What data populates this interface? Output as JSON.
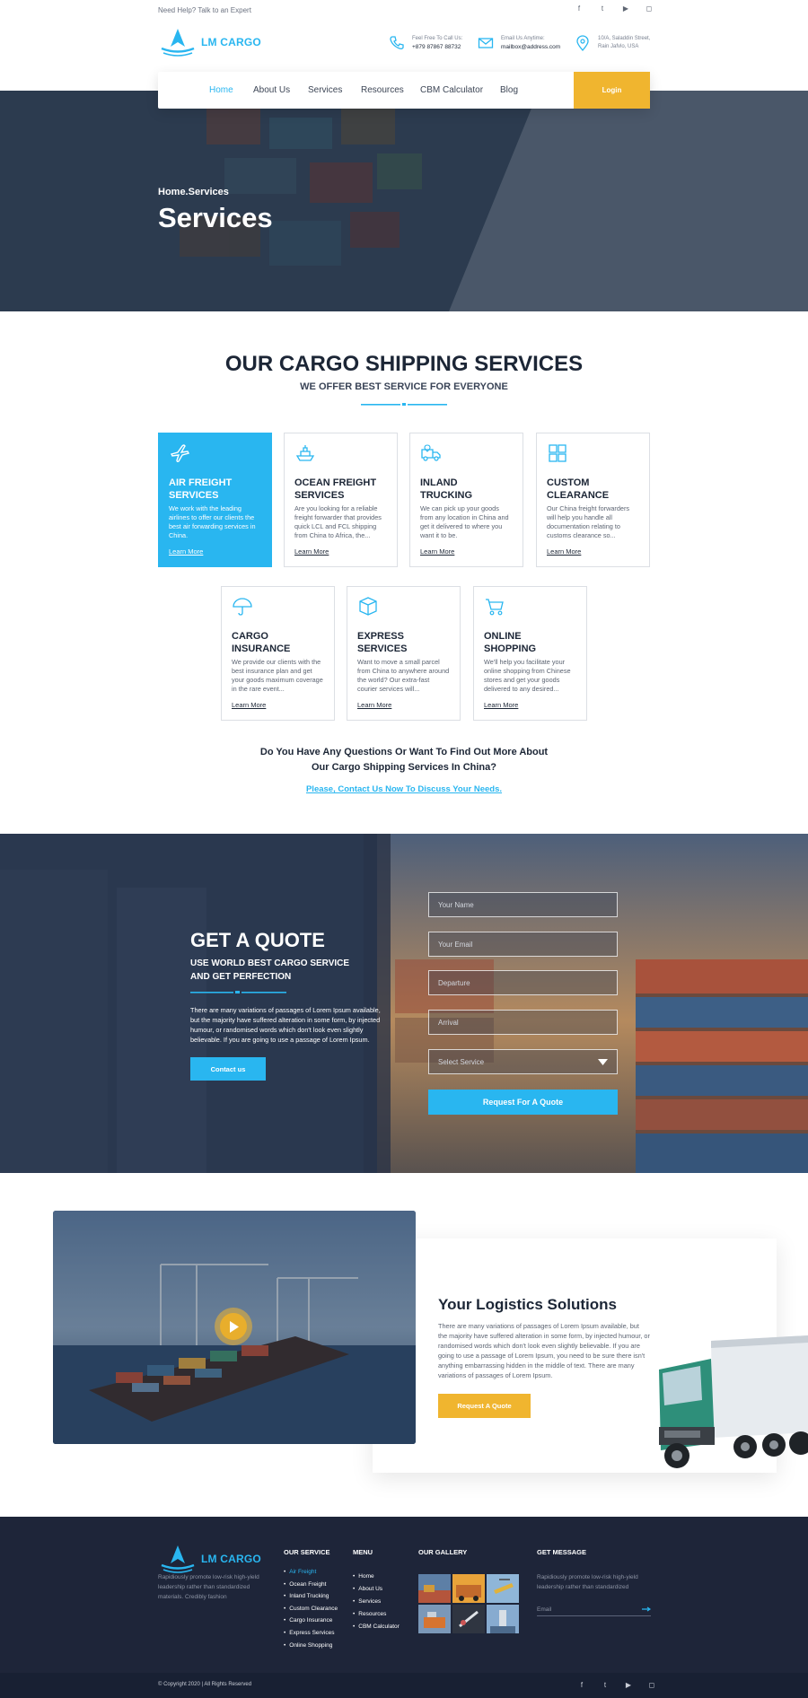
{
  "topbar": {
    "help": "Need Help? Talk to an Expert",
    "social": [
      {
        "icon": "facebook-icon",
        "glyph": "f"
      },
      {
        "icon": "twitter-icon",
        "glyph": "t"
      },
      {
        "icon": "youtube-icon",
        "glyph": "▶"
      },
      {
        "icon": "instagram-icon",
        "glyph": "◻"
      }
    ]
  },
  "brand": {
    "name": "LM CARGO",
    "accent": "#29b6f0",
    "yellow": "#f0b52f",
    "dark": "#1c2636"
  },
  "header": {
    "call": {
      "label": "Feel Free To Call Us:",
      "value": "+879 87867 88732"
    },
    "email": {
      "label": "Email Us Anytime:",
      "value": "mailbox@address.com"
    },
    "address": {
      "line1": "10/A, Saladdin Street,",
      "line2": "Rain Jafvlo, USA"
    }
  },
  "nav": {
    "items": [
      "Home",
      "About Us",
      "Services",
      "Resources",
      "CBM Calculator",
      "Blog"
    ],
    "active": "Home",
    "login": "Login"
  },
  "hero": {
    "breadcrumb": "Home.Services",
    "title": "Services"
  },
  "services": {
    "title": "OUR CARGO SHIPPING SERVICES",
    "subtitle": "WE OFFER BEST SERVICE FOR EVERYONE",
    "cards": [
      {
        "title1": "AIR FREIGHT",
        "title2": "SERVICES",
        "text": "We work with the leading airlines to offer our clients the best air forwarding services in China.",
        "more": "Learn More",
        "icon": "airplane-icon"
      },
      {
        "title1": "OCEAN FREIGHT",
        "title2": "SERVICES",
        "text": "Are you looking for a reliable freight forwarder that provides quick LCL and FCL shipping from China to Africa, the...",
        "more": "Learn More",
        "icon": "ship-icon"
      },
      {
        "title1": "INLAND",
        "title2": "TRUCKING",
        "text": "We can pick up your goods from any location in China and get it delivered to where you want it to be.",
        "more": "Learn More",
        "icon": "truck-icon"
      },
      {
        "title1": "CUSTOM",
        "title2": "CLEARANCE",
        "text": "Our China freight forwarders will help you handle all documentation relating to customs clearance so...",
        "more": "Learn More",
        "icon": "boxes-icon"
      },
      {
        "title1": "CARGO",
        "title2": "INSURANCE",
        "text": "We provide our clients with the best insurance plan and get your goods maximum coverage in the rare event...",
        "more": "Learn More",
        "icon": "umbrella-icon"
      },
      {
        "title1": "EXPRESS",
        "title2": "SERVICES",
        "text": "Want to move a small parcel from China to anywhere around the world? Our extra-fast courier services will...",
        "more": "Learn More",
        "icon": "package-icon"
      },
      {
        "title1": "ONLINE",
        "title2": "SHOPPING",
        "text": "We'll help you facilitate your online shopping from Chinese stores and get your goods delivered to any desired...",
        "more": "Learn More",
        "icon": "cart-icon"
      }
    ],
    "question1": "Do You Have Any Questions Or Want To Find Out More About",
    "question2": "Our Cargo Shipping Services In China?",
    "contact_link": "Please, Contact Us Now To Discuss Your Needs."
  },
  "quote": {
    "title": "GET A QUOTE",
    "subtitle1": "USE WORLD BEST CARGO SERVICE",
    "subtitle2": "AND GET PERFECTION",
    "text": "There are many variations of passages of Lorem Ipsum available, but the majority have suffered alteration in some form, by injected humour, or randomised words which don't look even slightly believable. If you are going to use a passage of Lorem Ipsum.",
    "button": "Contact us",
    "fields": {
      "name": "Your Name",
      "email": "Your Email",
      "departure": "Departure",
      "arrival": "Arrival",
      "service": "Select Service"
    },
    "submit": "Request For A Quote"
  },
  "logistics": {
    "title": "Your Logistics Solutions",
    "text": "There are many variations of passages of Lorem Ipsum available, but the majority have suffered alteration in some form, by injected humour, or randomised words which don't look even slightly believable. If you are going to use a passage of Lorem Ipsum, you need to be sure there isn't anything embarrassing hidden in the middle of text. There are many variations of passages of Lorem Ipsum.",
    "button": "Request A Quote"
  },
  "footer": {
    "desc": "Rapidiously promote low-risk high-yield leadership rather than standardized materials. Credibly fashion",
    "service_head": "OUR SERVICE",
    "services": [
      "Air Freight",
      "Ocean Freight",
      "Inland Trucking",
      "Custom Clearance",
      "Cargo Insurance",
      "Express Services",
      "Online Shopping"
    ],
    "menu_head": "MENU",
    "menu": [
      "Home",
      "About Us",
      "Services",
      "Resources",
      "CBM Calculator"
    ],
    "gallery_head": "OUR GALLERY",
    "message_head": "GET MESSAGE",
    "message_text": "Rapidiously promote low-risk high-yield leadership rather than standardized",
    "email_placeholder": "Email",
    "copyright": "© Copyright 2020 | All Rights Reserved"
  }
}
